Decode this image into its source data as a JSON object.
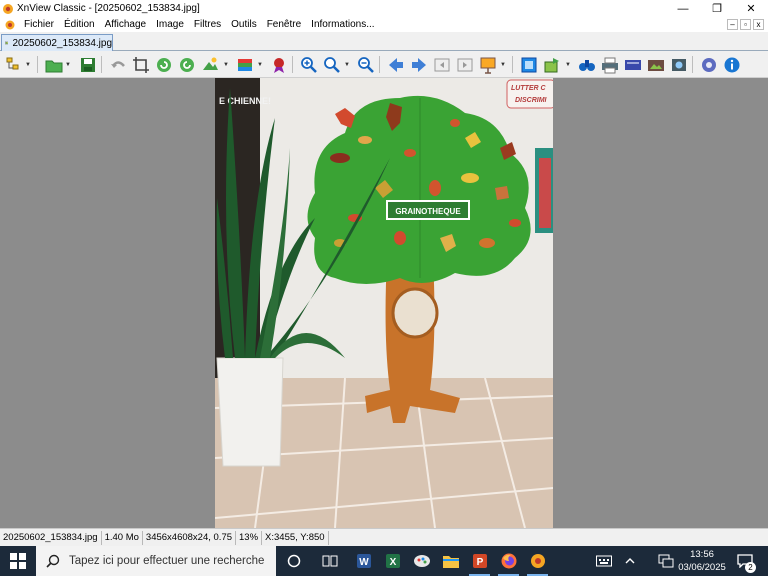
{
  "window": {
    "title": "XnView Classic - [20250602_153834.jpg]",
    "controls": {
      "minimize": "—",
      "maximize": "❐",
      "close": "✕"
    }
  },
  "menubar": {
    "items": [
      "Fichier",
      "Édition",
      "Affichage",
      "Image",
      "Filtres",
      "Outils",
      "Fenêtre",
      "Informations..."
    ],
    "mdi_controls": {
      "minimize": "–",
      "restore": "▫",
      "close": "x"
    }
  },
  "tab": {
    "label": "20250602_153834.jpg"
  },
  "toolbar": {
    "buttons": [
      "browser",
      "open",
      "save",
      "undo",
      "crop",
      "rotate-left",
      "rotate-right",
      "adjust",
      "color-depth",
      "filter",
      "zoom-in",
      "zoom-fit",
      "zoom-out",
      "previous",
      "next",
      "first",
      "last",
      "slideshow",
      "fullscreen",
      "convert",
      "search",
      "print",
      "scanner",
      "export",
      "capture",
      "settings",
      "about"
    ]
  },
  "image": {
    "sign_text": "GRAINOTHEQUE",
    "poster_text": "E CHIENNE!",
    "wall_sign_top": "LUTTER C",
    "wall_sign_bottom": "DISCRIMI"
  },
  "statusbar": {
    "filename": "20250602_153834.jpg",
    "filesize": "1.40 Mo",
    "dimensions": "3456x4608x24, 0.75",
    "zoom": "13%",
    "cursor": "X:3455, Y:850"
  },
  "taskbar": {
    "search_placeholder": "Tapez ici pour effectuer une recherche",
    "apps": [
      "cortana",
      "task-view",
      "word",
      "excel",
      "xnview-paint",
      "file-explorer",
      "powerpoint",
      "firefox",
      "xnview"
    ],
    "time": "13:56",
    "date": "03/06/2025",
    "notification_count": "2"
  },
  "colors": {
    "viewer_bg": "#8c8c8c",
    "taskbar_bg": "#1c2a3a",
    "canopy": "#3aa334",
    "trunk": "#c8732a",
    "tab_bg": "#dce9f8"
  }
}
